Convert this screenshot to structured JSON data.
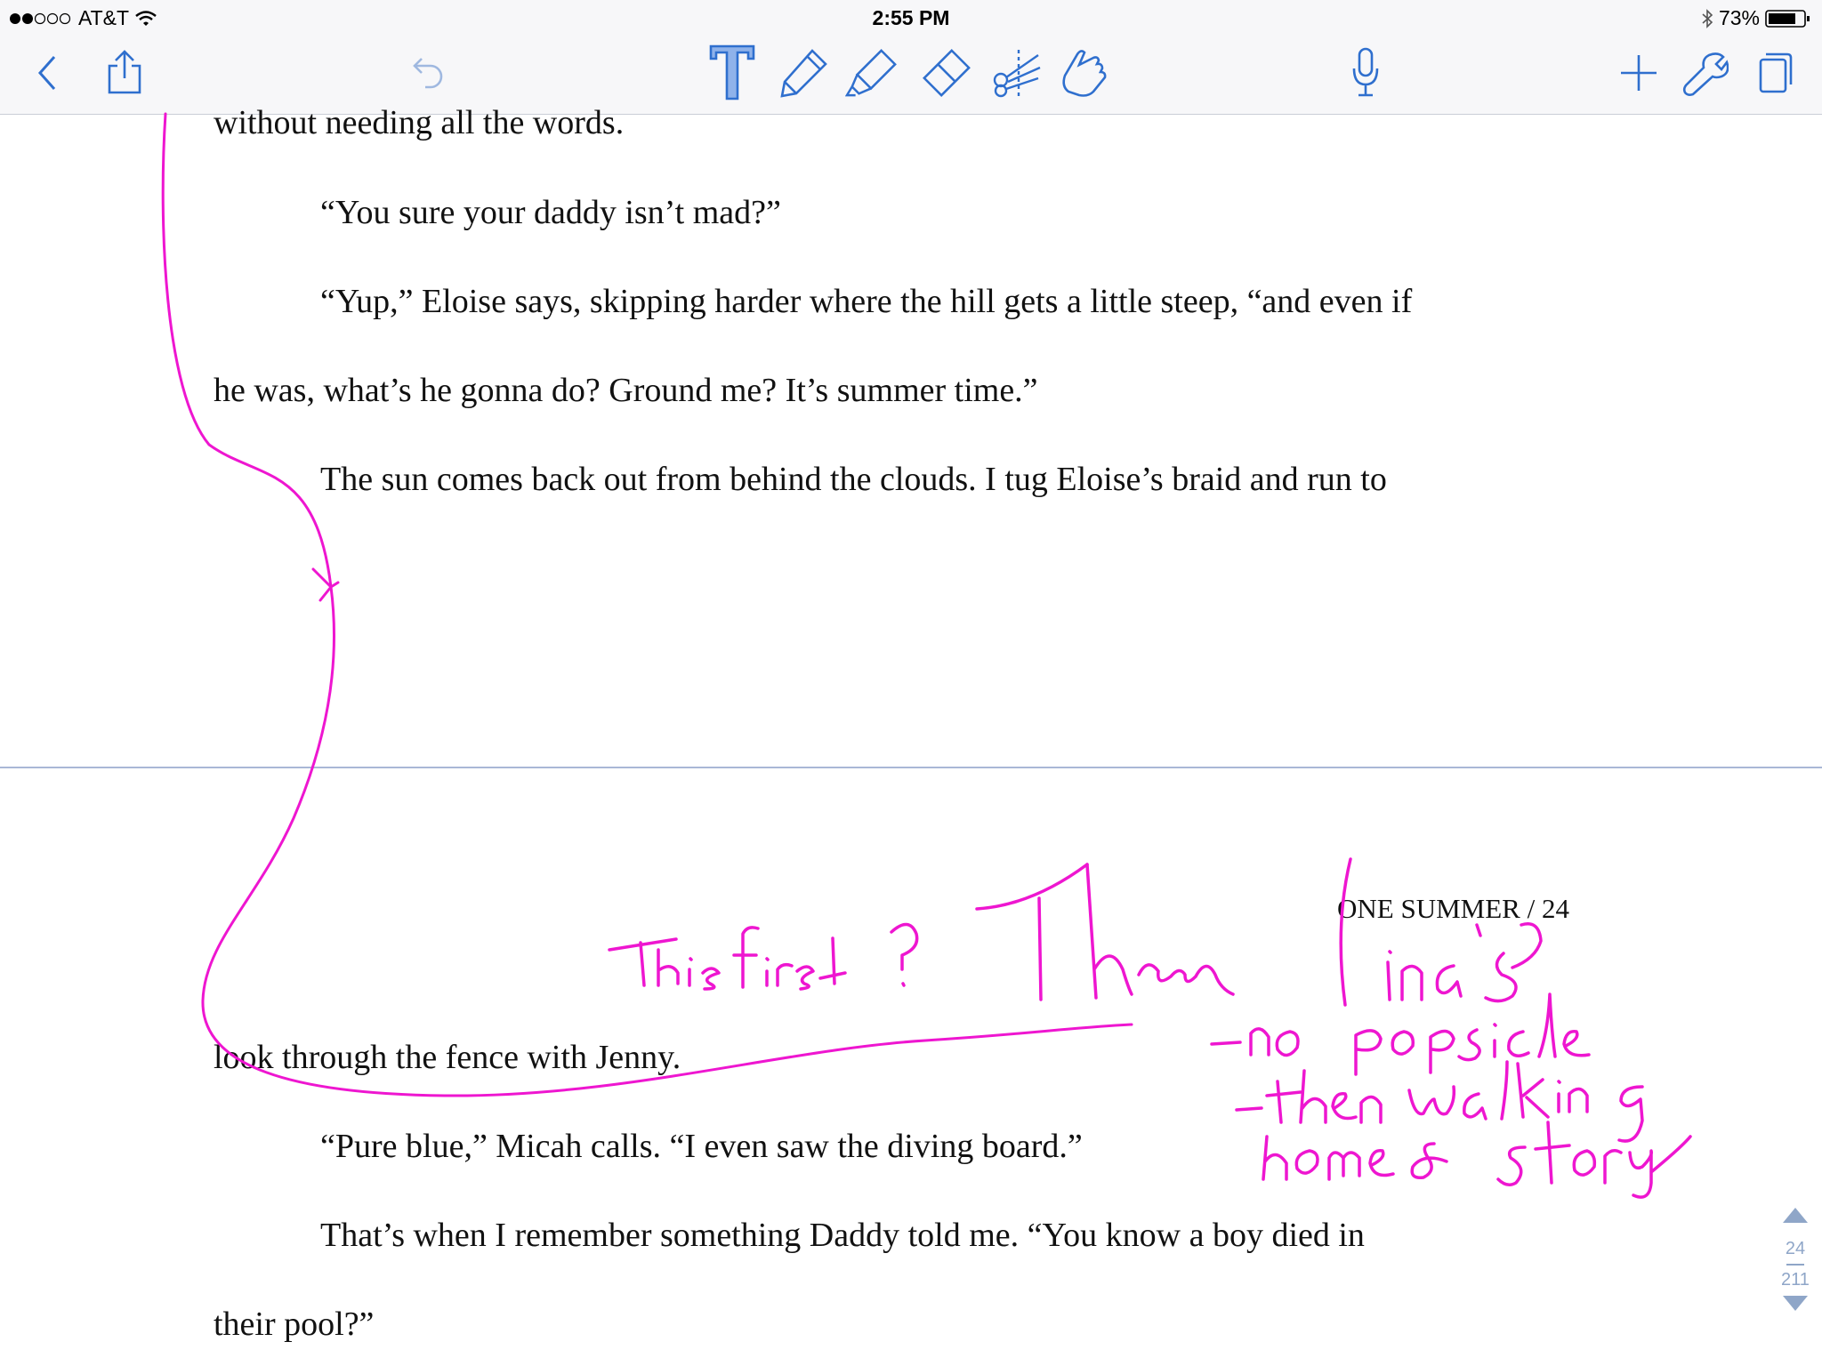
{
  "status_bar": {
    "carrier": "AT&T",
    "time": "2:55 PM",
    "battery": "73%",
    "icons": [
      "signal-dots-icon",
      "wifi-icon",
      "bluetooth-icon",
      "battery-icon"
    ]
  },
  "toolbar": {
    "left": [
      "back-chevron-icon",
      "share-icon"
    ],
    "middle": [
      "undo-icon",
      "text-tool-icon",
      "pen-tool-icon",
      "highlighter-tool-icon",
      "eraser-tool-icon",
      "scissors-tool-icon",
      "pointer-hand-icon"
    ],
    "mic": "microphone-icon",
    "right": [
      "add-icon",
      "wrench-icon",
      "pages-icon"
    ],
    "accent_color": "#2f6fce"
  },
  "document": {
    "lines": [
      "without needing all the words.",
      "“You sure your daddy isn’t mad?”",
      "“Yup,” Eloise says, skipping harder where the hill gets a little steep, “and even if",
      "he was, what’s he gonna do? Ground me? It’s summer time.”",
      "The sun comes back out from behind the clouds. I tug Eloise’s braid and run to",
      "look through the fence with Jenny.",
      "“Pure blue,” Micah calls. “I even saw the diving board.”",
      "That’s when I remember something Daddy told me. “You know a boy died in",
      "their pool?”"
    ],
    "page_header": "ONE SUMMER / 24"
  },
  "annotations": {
    "ink_color": "#ee16d0",
    "notes": [
      "This first?",
      "Then",
      "Lina's",
      "– no popsicle",
      "– then walking",
      "home & story"
    ]
  },
  "pager": {
    "current": "24",
    "total": "211"
  }
}
